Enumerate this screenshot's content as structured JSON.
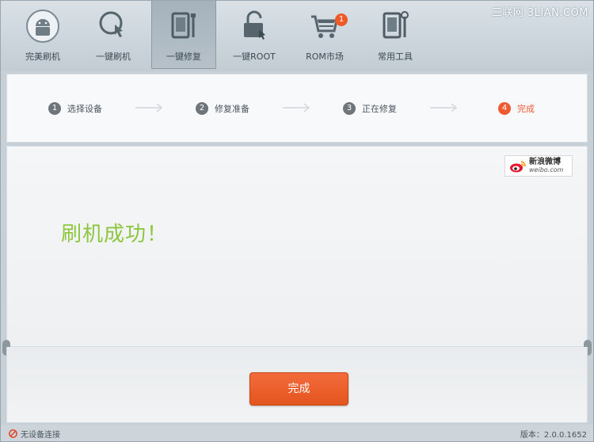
{
  "watermark": "三联网 3LIAN.COM",
  "toolbar": {
    "items": [
      {
        "label": "完美刷机",
        "icon": "android-icon"
      },
      {
        "label": "一键刷机",
        "icon": "one-click-flash-icon"
      },
      {
        "label": "一键修复",
        "icon": "repair-tools-icon"
      },
      {
        "label": "一键ROOT",
        "icon": "unlock-icon"
      },
      {
        "label": "ROM市场",
        "icon": "cart-icon",
        "badge": "1"
      },
      {
        "label": "常用工具",
        "icon": "tools-icon"
      }
    ],
    "active_index": 2
  },
  "steps": [
    {
      "num": "1",
      "label": "选择设备"
    },
    {
      "num": "2",
      "label": "修复准备"
    },
    {
      "num": "3",
      "label": "正在修复"
    },
    {
      "num": "4",
      "label": "完成"
    }
  ],
  "current_step": 4,
  "weibo": {
    "cn": "新浪微博",
    "en": "weibo.com"
  },
  "main": {
    "message": "刷机成功！"
  },
  "done_button": "完成",
  "status": {
    "connection": "无设备连接",
    "version": "版本：2.0.0.1652"
  },
  "colors": {
    "accent": "#ee5a31",
    "success": "#8dc63f",
    "button": "#ec5f2a"
  }
}
